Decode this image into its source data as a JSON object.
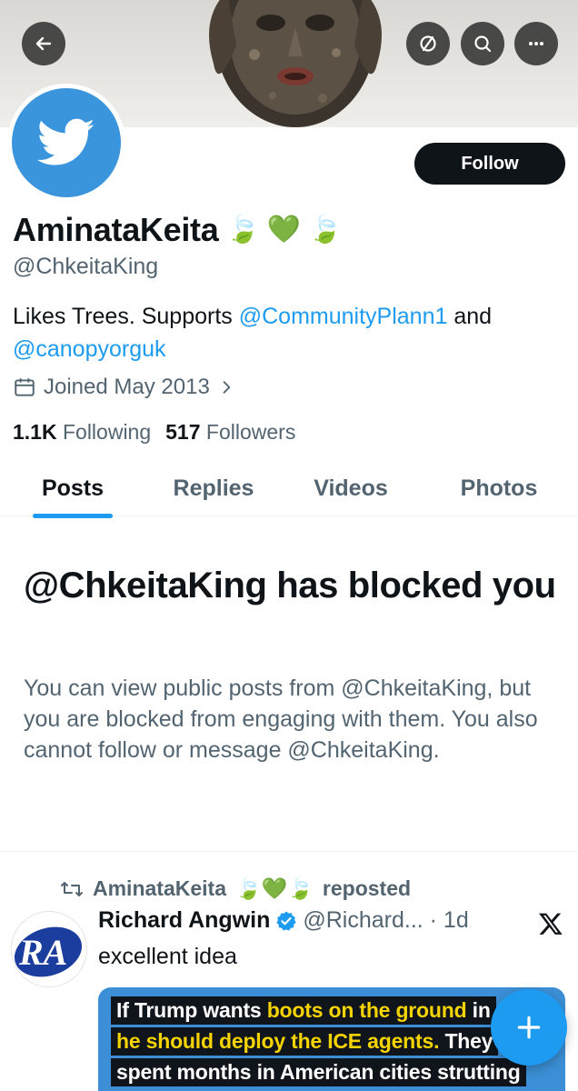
{
  "profile": {
    "display_name": "AminataKeita",
    "name_emojis": [
      "🍃",
      "💚",
      "🍃"
    ],
    "handle": "@ChkeitaKing",
    "bio_prefix": "Likes Trees. Supports ",
    "bio_mention_1": "@CommunityPlann1",
    "bio_mid": " and",
    "bio_mention_2": "@canopyorguk",
    "joined": "Joined May 2013",
    "following_count": "1.1K",
    "following_label": "Following",
    "followers_count": "517",
    "followers_label": "Followers",
    "follow_label": "Follow"
  },
  "tabs": [
    {
      "label": "Posts",
      "active": true
    },
    {
      "label": "Replies",
      "active": false
    },
    {
      "label": "Videos",
      "active": false
    },
    {
      "label": "Photos",
      "active": false
    }
  ],
  "blocked": {
    "title": "@ChkeitaKing has blocked you",
    "body": "You can view public posts from @ChkeitaKing, but you are blocked from engaging with them. You also cannot follow or message @ChkeitaKing."
  },
  "tweet": {
    "repost_name": "AminataKeita",
    "repost_emojis": "🍃💚🍃",
    "repost_suffix": "reposted",
    "author_name": "Richard Angwin",
    "author_meta": "@Richard... · 1d",
    "text": "excellent idea",
    "avatar_initials": "RA",
    "media_lines": [
      {
        "plain": "If Trump wants ",
        "highlight": "boots on the ground",
        "rest": " in"
      },
      {
        "plain": "",
        "highlight": "he should deploy the ICE agents.",
        "rest": " They"
      },
      {
        "plain": "spent months in American cities strutting",
        "highlight": "",
        "rest": ""
      }
    ]
  },
  "colors": {
    "accent": "#1d9bf0",
    "text_primary": "#0f1419",
    "text_secondary": "#536471",
    "follow_button": "#0f1419"
  },
  "icons": {
    "back": "arrow-left-icon",
    "no_notifications": "circle-slash-icon",
    "search": "search-icon",
    "more": "ellipsis-icon",
    "calendar": "calendar-icon",
    "repost": "repost-icon",
    "verified": "verified-badge-icon",
    "x_logo": "x-logo-icon",
    "compose": "plus-icon"
  }
}
